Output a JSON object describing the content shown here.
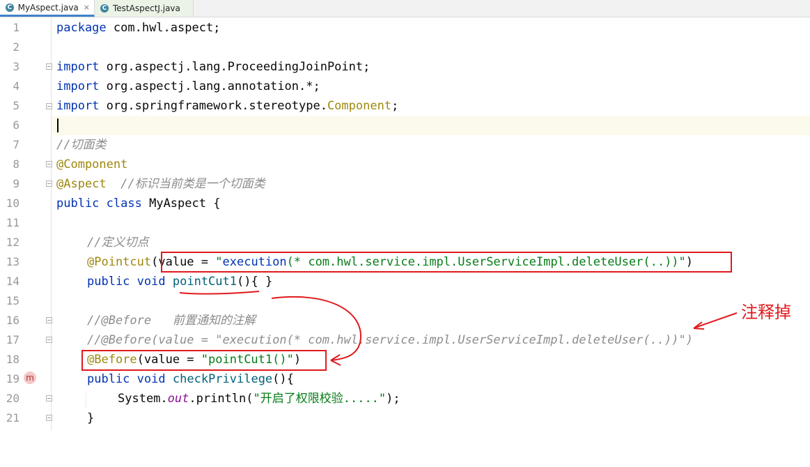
{
  "tabs": [
    {
      "label": "MyAspect.java",
      "icon": "c-class-icon",
      "icon_glyph": "C",
      "active": true,
      "close": "×"
    },
    {
      "label": "TestAspectJ.java",
      "icon": "c-class-icon",
      "icon_glyph": "C",
      "active": false
    }
  ],
  "line_numbers": [
    "1",
    "2",
    "3",
    "4",
    "5",
    "6",
    "7",
    "8",
    "9",
    "10",
    "11",
    "12",
    "13",
    "14",
    "15",
    "16",
    "17",
    "18",
    "19",
    "20",
    "21"
  ],
  "lines": {
    "l1": {
      "kw": "package",
      "rest": " com.hwl.aspect;"
    },
    "l3": {
      "kw": "import",
      "rest": " org.aspectj.lang.ProceedingJoinPoint;"
    },
    "l4": {
      "kw": "import",
      "rest": " org.aspectj.lang.annotation.*;"
    },
    "l5": {
      "kw": "import",
      "rest": " org.springframework.stereotype.",
      "comp": "Component",
      "end": ";"
    },
    "l7": {
      "comment": "//切面类"
    },
    "l8": {
      "ann": "@Component"
    },
    "l9": {
      "ann": "@Aspect",
      "gap": "  ",
      "comment": "//标识当前类是一个切面类"
    },
    "l10": {
      "kw1": "public",
      "kw2": "class",
      "rest": " MyAspect {"
    },
    "l12": {
      "comment": "//定义切点"
    },
    "l13": {
      "ann": "@Pointcut",
      "p1": "(value = ",
      "str_q": "\"",
      "str_method": "execution",
      "str_rest": "(* com.hwl.service.impl.UserServiceImpl.deleteUser(..))",
      "str_end": "\"",
      "p2": ")"
    },
    "l14": {
      "kw1": "public",
      "kw2": "void",
      "method": "pointCut1",
      "rest": "(){ }"
    },
    "l16": {
      "comment": "//@Before   前置通知的注解"
    },
    "l17": {
      "comment": "//@Before(value = \"execution(* com.hwl.service.impl.UserServiceImpl.deleteUser(..))\")"
    },
    "l18": {
      "ann": "@Before",
      "p1": "(value = ",
      "str": "\"pointCut1()\"",
      "p2": ")"
    },
    "l19": {
      "kw1": "public",
      "kw2": "void",
      "method": "checkPrivilege",
      "rest": "(){"
    },
    "l20": {
      "pre": "System.",
      "field": "out",
      "mid": ".println(",
      "str": "\"开启了权限校验.....\"",
      "end": ");"
    },
    "l21": {
      "rest": "}"
    }
  },
  "gutter_marker": {
    "icon": "method-override-icon",
    "glyph": "m"
  },
  "annotation_note": "注释掉",
  "colors": {
    "keyword": "#0033b3",
    "annotation": "#9e880d",
    "comment": "#8c8c8c",
    "string": "#067d17",
    "method": "#00627a",
    "markup_red": "#e0191d"
  }
}
